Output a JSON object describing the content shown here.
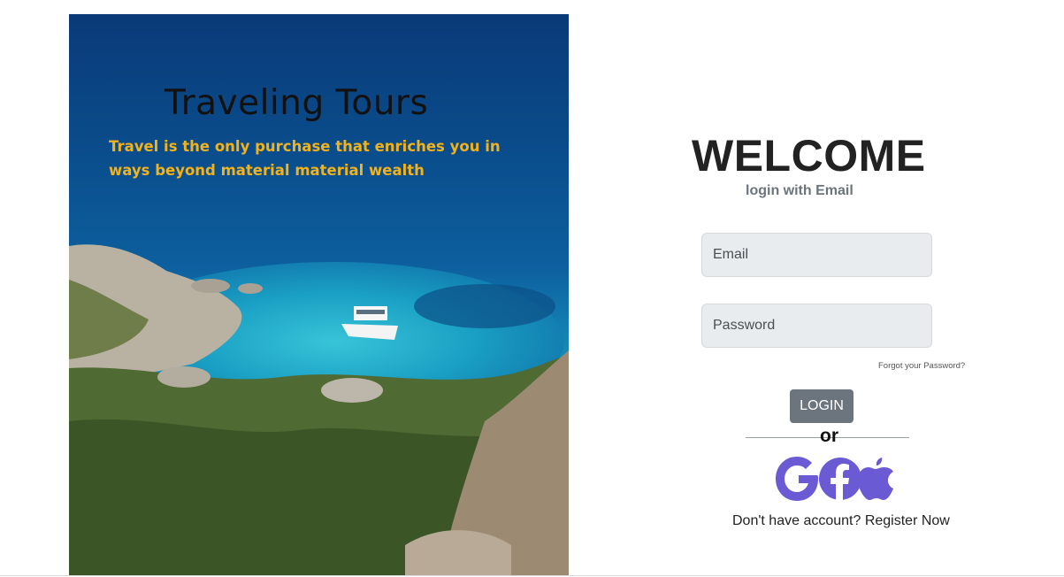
{
  "hero": {
    "title": "Traveling Tours",
    "tagline": "Travel is the only purchase that enriches you in ways beyond material material wealth"
  },
  "login": {
    "heading": "WELCOME",
    "subheading": "login with Email",
    "email_placeholder": "Email",
    "password_placeholder": "Password",
    "forgot_label": "Forgot your Password?",
    "login_label": "LOGIN",
    "or_label": "or",
    "social_icons": [
      "google-icon",
      "facebook-icon",
      "apple-icon"
    ],
    "register_prompt": "Don't have account?",
    "register_link": "Register Now"
  },
  "colors": {
    "tagline": "#f2b21b",
    "button": "#6c757d",
    "social": "#6a5ad4",
    "input_bg": "#e9ecef"
  }
}
